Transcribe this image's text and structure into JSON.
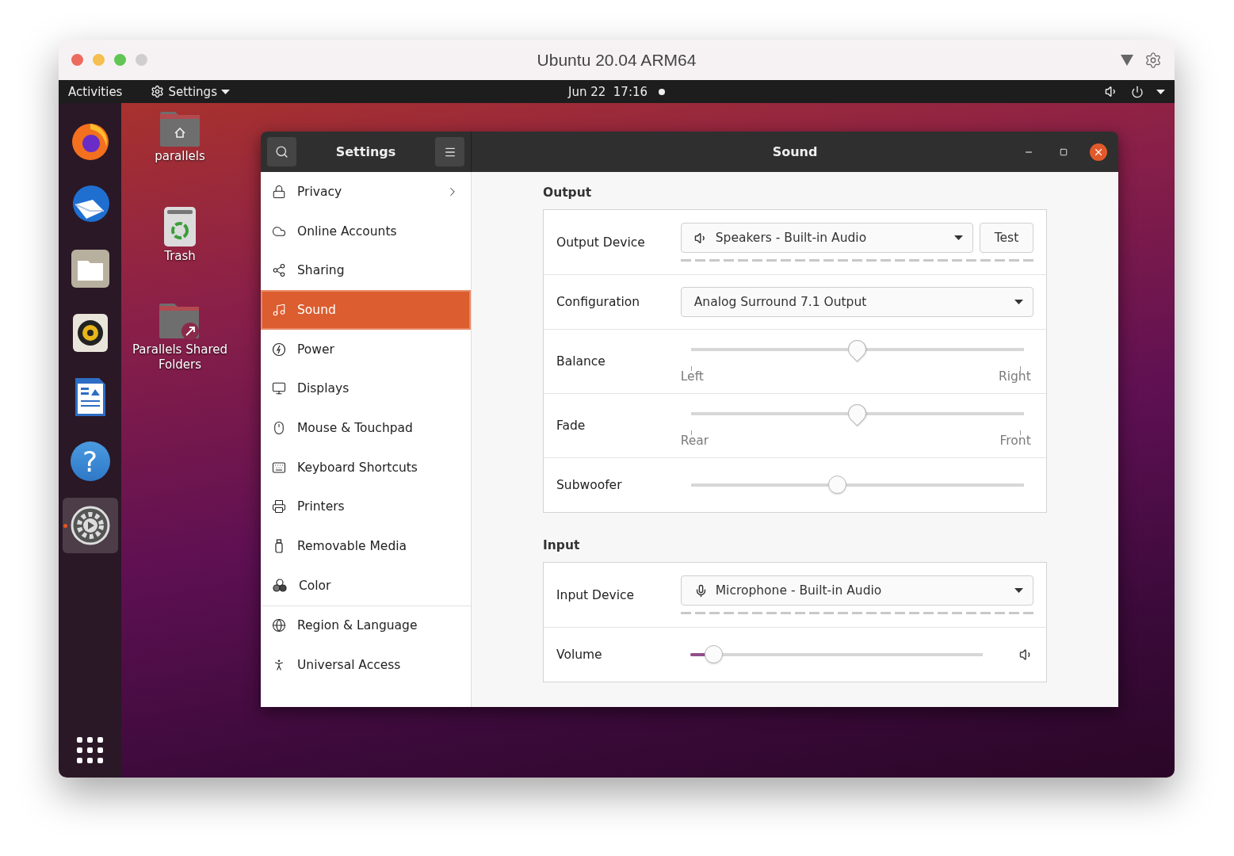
{
  "mac_window": {
    "title": "Ubuntu 20.04 ARM64"
  },
  "top_bar": {
    "activities": "Activities",
    "app_menu": "Settings",
    "clock": "Jun 22  17:16"
  },
  "dock": [
    {
      "kind": "firefox",
      "selected": false
    },
    {
      "kind": "thunderbird",
      "selected": false
    },
    {
      "kind": "files",
      "selected": false
    },
    {
      "kind": "rhythmbox",
      "selected": false
    },
    {
      "kind": "writer",
      "selected": false
    },
    {
      "kind": "help",
      "glyph": "?",
      "selected": false
    },
    {
      "kind": "settings",
      "selected": true
    }
  ],
  "desktop_icons": [
    {
      "label": "parallels",
      "kind": "home"
    },
    {
      "label": "Trash",
      "kind": "trash"
    },
    {
      "label": "Parallels Shared Folders",
      "kind": "shared"
    }
  ],
  "settings_window": {
    "sidebar_title": "Settings",
    "page_title": "Sound",
    "sidebar_groups": [
      [
        {
          "label": "Privacy",
          "has_submenu": true,
          "selected": false
        },
        {
          "label": "Online Accounts",
          "has_submenu": false,
          "selected": false
        },
        {
          "label": "Sharing",
          "has_submenu": false,
          "selected": false
        },
        {
          "label": "Sound",
          "has_submenu": false,
          "selected": true
        },
        {
          "label": "Power",
          "has_submenu": false,
          "selected": false
        },
        {
          "label": "Displays",
          "has_submenu": false,
          "selected": false
        },
        {
          "label": "Mouse & Touchpad",
          "has_submenu": false,
          "selected": false
        },
        {
          "label": "Keyboard Shortcuts",
          "has_submenu": false,
          "selected": false
        },
        {
          "label": "Printers",
          "has_submenu": false,
          "selected": false
        },
        {
          "label": "Removable Media",
          "has_submenu": false,
          "selected": false
        },
        {
          "label": "Color",
          "has_submenu": false,
          "selected": false
        }
      ],
      [
        {
          "label": "Region & Language",
          "has_submenu": false,
          "selected": false
        },
        {
          "label": "Universal Access",
          "has_submenu": false,
          "selected": false
        }
      ]
    ],
    "sections": [
      {
        "heading": "Output",
        "rows": [
          {
            "kind": "output-device",
            "label": "Output Device",
            "value": "Speakers - Built-in Audio",
            "button": "Test",
            "meter": true
          },
          {
            "kind": "dropdown",
            "label": "Configuration",
            "value": "Analog Surround 7.1 Output"
          },
          {
            "kind": "slider",
            "label": "Balance",
            "level": 0.5,
            "min_label": "Left",
            "max_label": "Right"
          },
          {
            "kind": "slider",
            "label": "Fade",
            "level": 0.5,
            "min_label": "Rear",
            "max_label": "Front"
          },
          {
            "kind": "slider",
            "label": "Subwoofer",
            "level": 0.44
          }
        ]
      },
      {
        "heading": "Input",
        "rows": [
          {
            "kind": "input-device",
            "label": "Input Device",
            "value": "Microphone - Built-in Audio",
            "meter": true
          },
          {
            "kind": "volume",
            "label": "Volume",
            "level": 0.08
          }
        ]
      }
    ]
  }
}
